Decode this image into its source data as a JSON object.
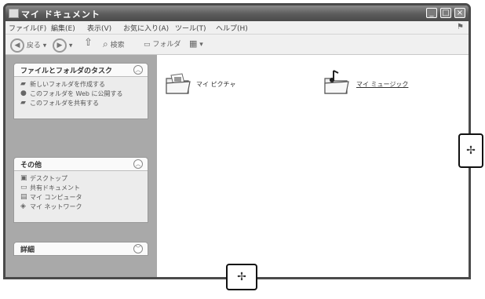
{
  "window": {
    "title": "マイ ドキュメント"
  },
  "title_buttons": {
    "minimize": "_",
    "maximize": "□",
    "close": "×"
  },
  "menubar": [
    "ファイル(F)",
    "編集(E)",
    "表示(V)",
    "お気に入り(A)",
    "ツール(T)",
    "ヘルプ(H)"
  ],
  "toolbar": {
    "back": "戻る",
    "search": "検索",
    "folders": "フォルダ"
  },
  "panels": {
    "tasks": {
      "title": "ファイルとフォルダのタスク",
      "items": [
        {
          "icon": "new-folder-icon",
          "label": "新しいフォルダを作成する"
        },
        {
          "icon": "publish-web-icon",
          "label": "このフォルダを Web に公開する"
        },
        {
          "icon": "share-folder-icon",
          "label": "このフォルダを共有する"
        }
      ]
    },
    "other": {
      "title": "その他",
      "items": [
        {
          "icon": "desktop-icon",
          "label": "デスクトップ"
        },
        {
          "icon": "shared-documents-icon",
          "label": "共有ドキュメント"
        },
        {
          "icon": "my-computer-icon",
          "label": "マイ コンピュータ"
        },
        {
          "icon": "network-icon",
          "label": "マイ ネットワーク"
        }
      ]
    },
    "details": {
      "title": "詳細"
    }
  },
  "folders": [
    {
      "name": "マイ ピクチャ",
      "icon": "pictures-folder-icon"
    },
    {
      "name": "マイ ミュージック",
      "icon": "music-folder-icon"
    }
  ],
  "resize_cursor": "✢"
}
